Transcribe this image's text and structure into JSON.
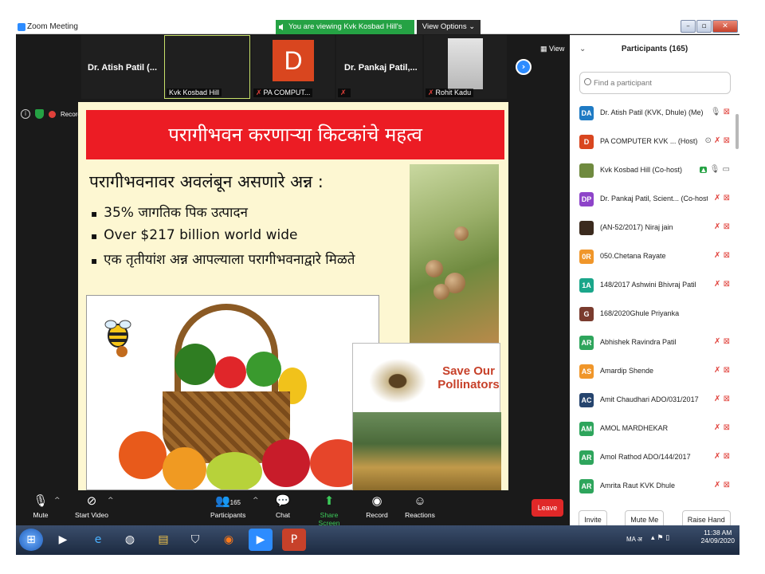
{
  "window": {
    "title": "Zoom Meeting",
    "banner": "You are viewing Kvk Kosbad Hill's screen",
    "view_options": "View Options ⌄"
  },
  "thumbnails": [
    {
      "name": "Dr. Atish Patil (...",
      "label": ""
    },
    {
      "name": "",
      "label": "Kvk Kosbad Hill"
    },
    {
      "name": "D",
      "label": "PA COMPUT..."
    },
    {
      "name": "Dr. Pankaj Patil,...",
      "label": ""
    },
    {
      "name": "",
      "label": "Rohit Kadu"
    }
  ],
  "view_btn": "View",
  "recording": "Recording",
  "slide": {
    "title": "परागीभवन करणाऱ्या किटकांचे महत्व",
    "heading": "परागीभवनावर अवलंबून असणारे अन्न :",
    "bullets": [
      "35% जागतिक पिक उत्पादन",
      "Over $217 billion world wide",
      "एक तृतीयांश अन्न आपल्याला परागीभवनाद्वारे मिळते"
    ],
    "save_text": "Save Our Pollinators"
  },
  "panel": {
    "title": "Participants (165)",
    "search_placeholder": "Find a participant",
    "participants": [
      {
        "initials": "DA",
        "name": "Dr. Atish Patil (KVK, Dhule) (Me)",
        "color": "#1f7bc4"
      },
      {
        "initials": "D",
        "name": "PA COMPUTER KVK ... (Host)",
        "color": "#d9461f"
      },
      {
        "initials": "",
        "name": "Kvk Kosbad Hill (Co-host)",
        "color": "#6f8a3f"
      },
      {
        "initials": "DP",
        "name": "Dr. Pankaj Patil, Scient... (Co-host)",
        "color": "#8e44c9"
      },
      {
        "initials": "",
        "name": "(AN-52/2017) Niraj jain",
        "color": "#3b2a1e"
      },
      {
        "initials": "0R",
        "name": "050.Chetana Rayate",
        "color": "#f0962a"
      },
      {
        "initials": "1A",
        "name": "148/2017 Ashwini Bhivraj Patil",
        "color": "#1aa68a"
      },
      {
        "initials": "G",
        "name": "168/2020Ghule Priyanka",
        "color": "#7a3b2e"
      },
      {
        "initials": "AR",
        "name": "Abhishek Ravindra Patil",
        "color": "#2ea55c"
      },
      {
        "initials": "AS",
        "name": "Amardip Shende",
        "color": "#f0962a"
      },
      {
        "initials": "AC",
        "name": "Amit Chaudhari ADO/031/2017",
        "color": "#25446e"
      },
      {
        "initials": "AM",
        "name": "AMOL MARDHEKAR",
        "color": "#2ea55c"
      },
      {
        "initials": "AR",
        "name": "Amol Rathod ADO/144/2017",
        "color": "#2ea55c"
      },
      {
        "initials": "AR",
        "name": "Amrita Raut KVK Dhule",
        "color": "#2ea55c"
      }
    ],
    "footer": {
      "invite": "Invite",
      "mute_me": "Mute Me",
      "raise_hand": "Raise Hand"
    }
  },
  "toolbar": {
    "mute": "Mute",
    "start_video": "Start Video",
    "participants": "Participants",
    "participants_count": "165",
    "chat": "Chat",
    "share_screen": "Share Screen",
    "record": "Record",
    "reactions": "Reactions",
    "leave": "Leave"
  },
  "taskbar": {
    "lang": "MA अ",
    "time": "11:38 AM",
    "date": "24/09/2020"
  }
}
